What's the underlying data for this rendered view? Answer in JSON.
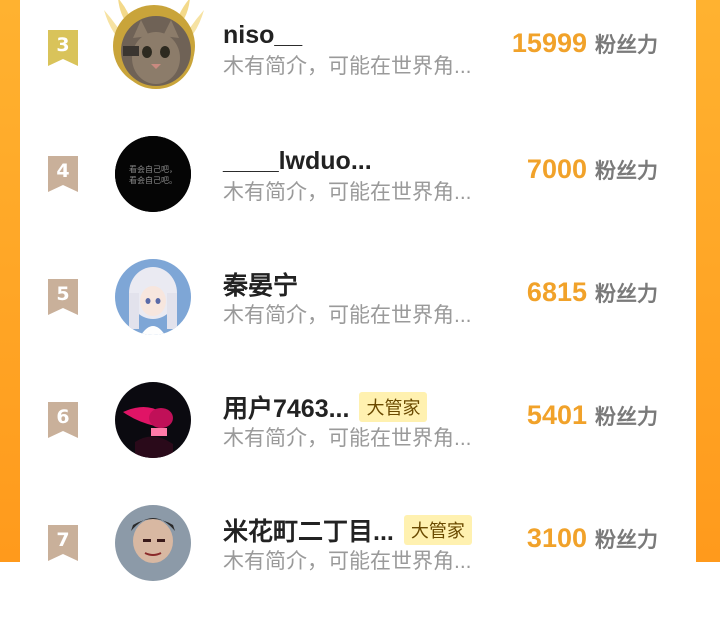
{
  "colors": {
    "accent": "#ffa424",
    "score": "#f1a22a",
    "rank_top": "#d9c35a",
    "rank_other": "#c9b09a",
    "badge_bg": "#fff1b0"
  },
  "rows": [
    {
      "rank": "3",
      "name": "niso__",
      "bio": "木有简介，可能在世界角...",
      "score": "15999",
      "unit": "粉丝力",
      "badge": ""
    },
    {
      "rank": "4",
      "name": "____lwduo...",
      "bio": "木有简介，可能在世界角...",
      "score": "7000",
      "unit": "粉丝力",
      "badge": ""
    },
    {
      "rank": "5",
      "name": "秦晏宁",
      "bio": "木有简介，可能在世界角...",
      "score": "6815",
      "unit": "粉丝力",
      "badge": ""
    },
    {
      "rank": "6",
      "name": "用户7463...",
      "bio": "木有简介，可能在世界角...",
      "score": "5401",
      "unit": "粉丝力",
      "badge": "大管家"
    },
    {
      "rank": "7",
      "name": "米花町二丁目...",
      "bio": "木有简介，可能在世界角...",
      "score": "3100",
      "unit": "粉丝力",
      "badge": "大管家"
    }
  ],
  "avatar_texts": {
    "row2_line1": "看会自己吧，",
    "row2_line2": "看会自己吧。"
  }
}
